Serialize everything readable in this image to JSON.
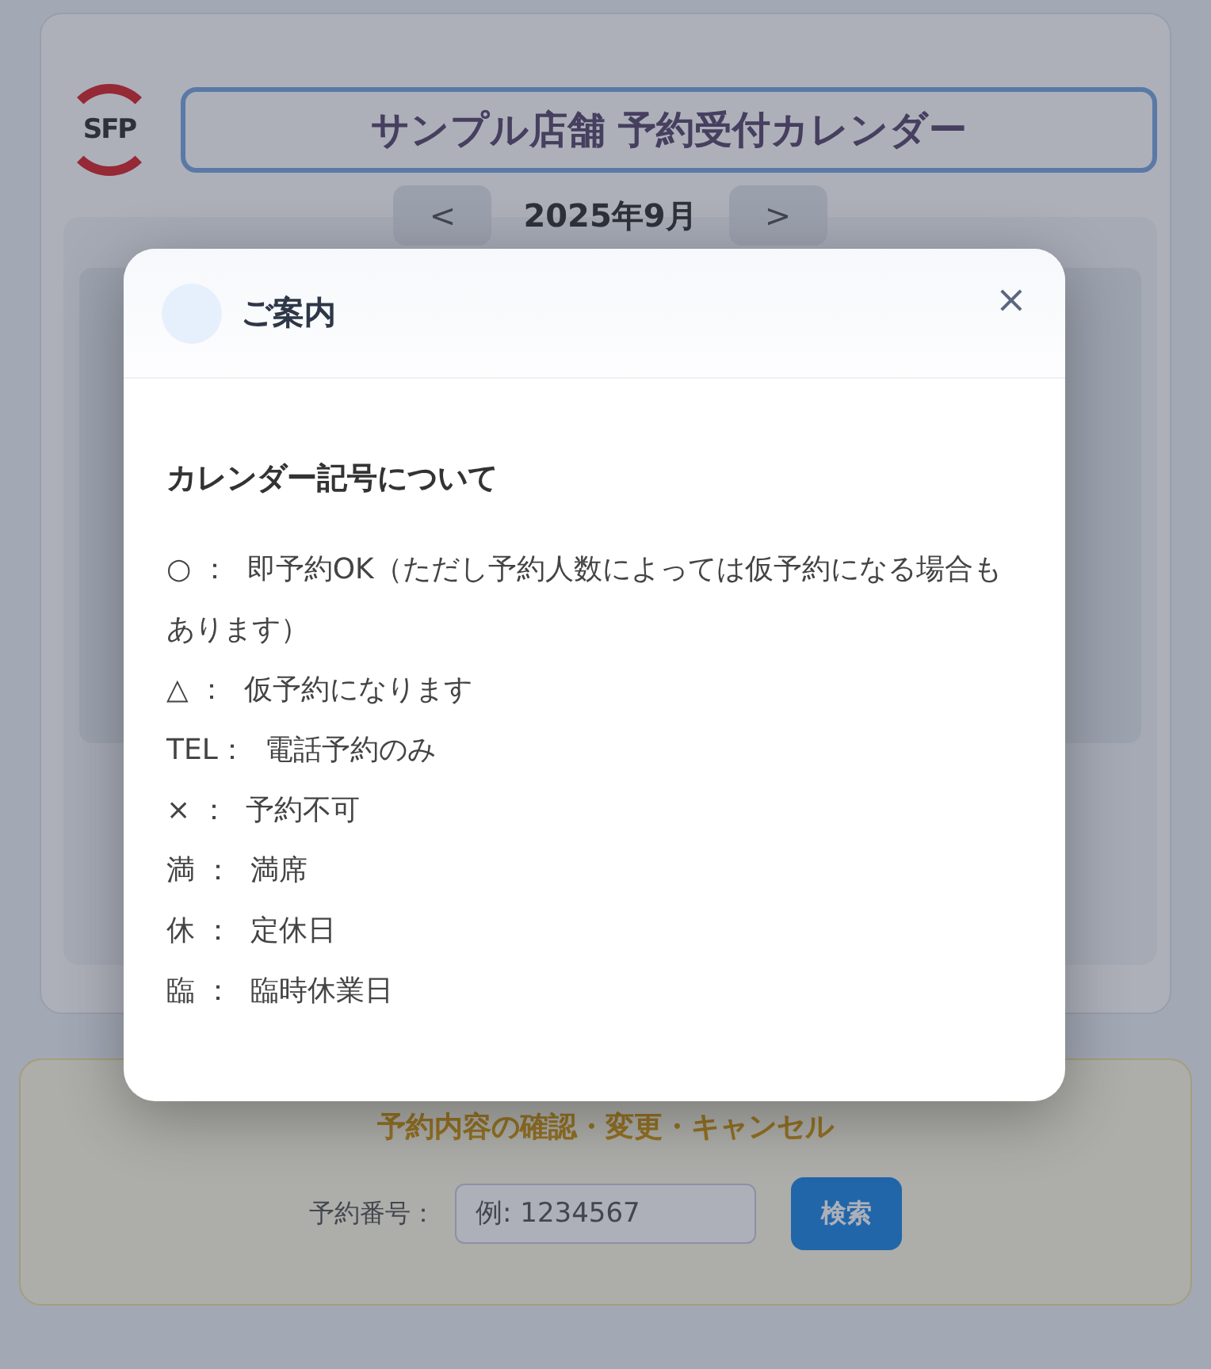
{
  "background": {
    "logo": "SFP",
    "title": "サンプル店舗 予約受付カレンダー",
    "month": "2025年9月",
    "prev_button": "<",
    "next_button": ">",
    "lookup": {
      "heading": "予約内容の確認・変更・キャンセル",
      "label": "予約番号：",
      "placeholder": "例: 1234567",
      "button": "検索"
    }
  },
  "modal": {
    "title": "ご案内",
    "close": "×",
    "heading": "カレンダー記号について",
    "items": [
      "○ ：  即予約OK（ただし予約人数によっては仮予約になる場合もあります）",
      "△ ：  仮予約になります",
      "TEL：  電話予約のみ",
      "× ：  予約不可",
      "満 ：  満席",
      "休 ：  定休日",
      "臨 ：  臨時休業日"
    ]
  }
}
